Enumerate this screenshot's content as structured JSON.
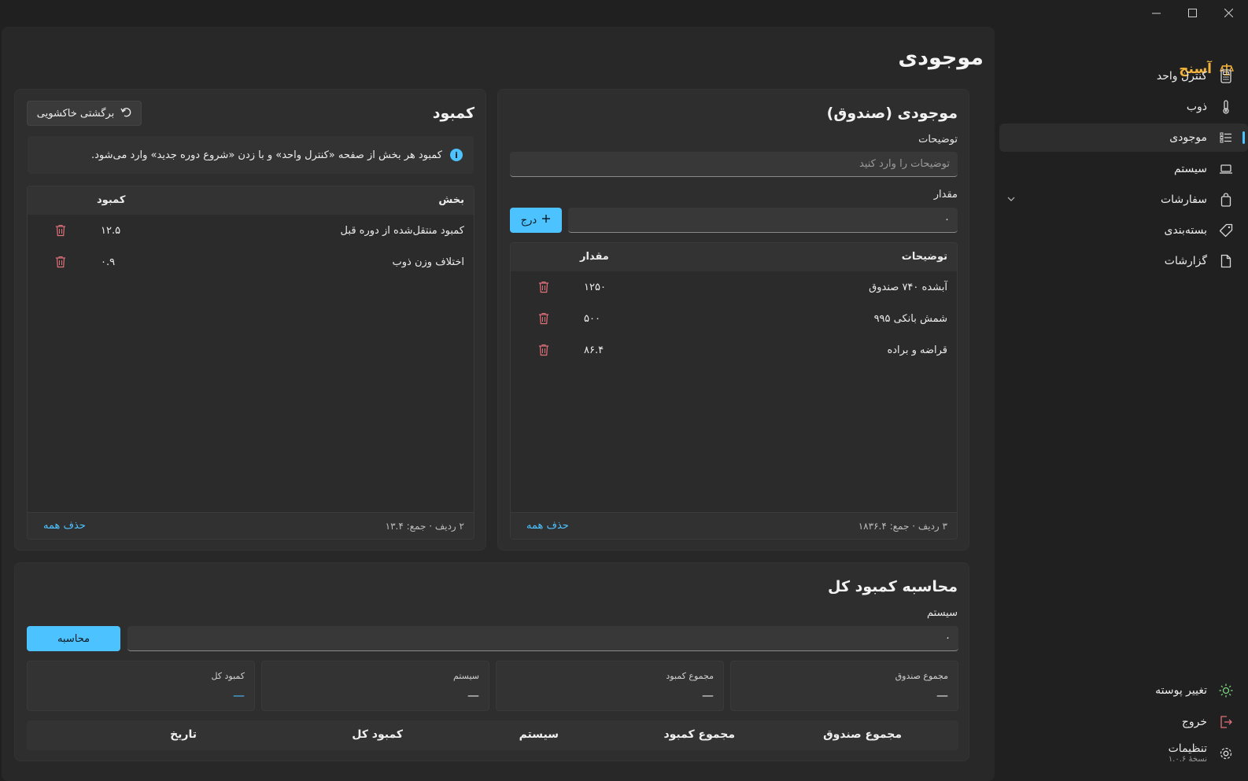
{
  "window": {
    "minimize": "—",
    "maximize": "☐",
    "close": "✕"
  },
  "sidebar": {
    "brand": "آسنج",
    "items": [
      {
        "label": "کنترل واحد",
        "icon": "calculator-icon"
      },
      {
        "label": "ذوب",
        "icon": "thermometer-icon"
      },
      {
        "label": "موجودی",
        "icon": "list-icon",
        "active": true
      },
      {
        "label": "سیستم",
        "icon": "laptop-icon"
      },
      {
        "label": "سفارشات",
        "icon": "bag-icon",
        "expandable": true
      },
      {
        "label": "بسته‌بندی",
        "icon": "tag-icon"
      },
      {
        "label": "گزارشات",
        "icon": "document-icon"
      }
    ],
    "footer": {
      "theme": "تغییر پوسته",
      "logout": "خروج",
      "settings": "تنظیمات",
      "version": "نسخهٔ ۱.۰.۶"
    }
  },
  "page": {
    "title": "موجودی"
  },
  "box": {
    "title": "موجودی (صندوق)",
    "desc_label": "توضیحات",
    "desc_placeholder": "توضیحات را وارد کنید",
    "amount_label": "مقدار",
    "amount_value": "۰",
    "insert_label": "درج",
    "columns": {
      "desc": "توضیحات",
      "amount": "مقدار"
    },
    "rows": [
      {
        "desc": "آبشده ۷۴۰ صندوق",
        "amount": "۱۲۵۰"
      },
      {
        "desc": "شمش بانکی ۹۹۵",
        "amount": "۵۰۰"
      },
      {
        "desc": "قراضه و براده",
        "amount": "۸۶.۴"
      }
    ],
    "summary": "۳ ردیف · جمع: ۱۸۳۶.۴",
    "delete_all": "حذف همه"
  },
  "deficit": {
    "title": "کمبود",
    "restore_label": "برگشتی خاکشویی",
    "info": "کمبود هر بخش از صفحه «کنترل واحد» و با زدن «شروع دوره جدید» وارد می‌شود.",
    "columns": {
      "section": "بخش",
      "deficit": "کمبود"
    },
    "rows": [
      {
        "section": "کمبود منتقل‌شده از دوره قبل",
        "deficit": "۱۲.۵"
      },
      {
        "section": "اختلاف وزن ذوب",
        "deficit": "۰.۹"
      }
    ],
    "summary": "۲ ردیف · جمع: ۱۳.۴",
    "delete_all": "حذف همه"
  },
  "calc": {
    "title": "محاسبه کمبود کل",
    "system_label": "سیستم",
    "system_value": "۰",
    "calc_button": "محاسبه",
    "stats": [
      {
        "label": "مجموع صندوق",
        "value": "—"
      },
      {
        "label": "مجموع کمبود",
        "value": "—"
      },
      {
        "label": "سیستم",
        "value": "—"
      },
      {
        "label": "کمبود کل",
        "value": "—"
      }
    ],
    "history_columns": [
      "مجموع صندوق",
      "مجموع کمبود",
      "سیستم",
      "کمبود کل",
      "تاریخ"
    ]
  },
  "colors": {
    "accent": "#4cc2ff",
    "brand": "#f2b33d",
    "danger": "#e0707a",
    "background": "#202020"
  }
}
